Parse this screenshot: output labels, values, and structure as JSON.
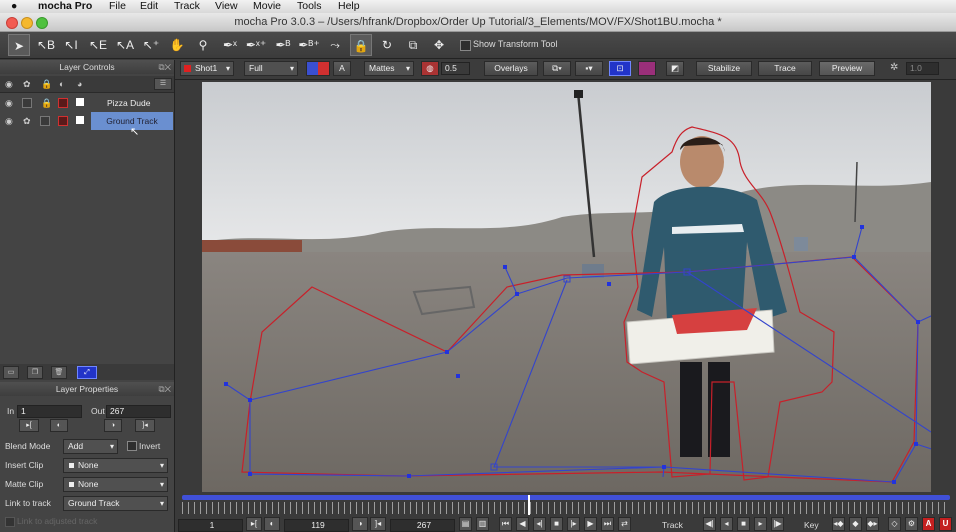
{
  "menu": {
    "apple": "",
    "app": "mocha Pro",
    "items": [
      "File",
      "Edit",
      "Track",
      "View",
      "Movie",
      "Tools",
      "Help"
    ]
  },
  "window": {
    "title": "mocha Pro 3.0.3 – /Users/hfrank/Dropbox/Order Up Tutorial/3_Elements/MOV/FX/Shot1BU.mocha *"
  },
  "toolbar": {
    "tools": [
      "pick-tool",
      "select-B",
      "select-I",
      "select-E",
      "select-A",
      "add-point",
      "pan",
      "zoom",
      "x-spline",
      "add-x-spline",
      "bezier",
      "add-bezier",
      "attach",
      "magnetic",
      "rotate",
      "scale",
      "move"
    ],
    "show_transform_tool": "Show Transform Tool"
  },
  "options": {
    "clip": "Shot1",
    "resolution": "Full",
    "view_mode": "A",
    "mattes": "Mattes",
    "opacity": "0.5",
    "overlays": "Overlays",
    "stabilize": "Stabilize",
    "trace": "Trace",
    "preview": "Preview",
    "value_field": "1.0"
  },
  "layer_controls": {
    "title": "Layer Controls",
    "layers": [
      {
        "name": "Pizza Dude",
        "color": "#dd3333",
        "selected": false
      },
      {
        "name": "Ground Track",
        "color": "#dd3333",
        "selected": true
      }
    ]
  },
  "layer_properties": {
    "title": "Layer Properties",
    "in_label": "In",
    "in_value": "1",
    "out_label": "Out",
    "out_value": "267",
    "blend_mode_label": "Blend Mode",
    "blend_mode": "Add",
    "invert_label": "Invert",
    "insert_clip_label": "Insert Clip",
    "insert_clip": "None",
    "matte_clip_label": "Matte Clip",
    "matte_clip": "None",
    "link_to_track_label": "Link to track",
    "link_to_track": "Ground Track",
    "link_adjusted_label": "Link to adjusted track"
  },
  "timeline": {
    "start": "1",
    "current": "119",
    "end": "267",
    "track_label": "Track",
    "key_label": "Key",
    "playhead_fraction": 0.45
  },
  "colors": {
    "accent_blue": "#3344cc",
    "spline_red": "#c8202a",
    "selected_layer": "#6a8fd0"
  }
}
